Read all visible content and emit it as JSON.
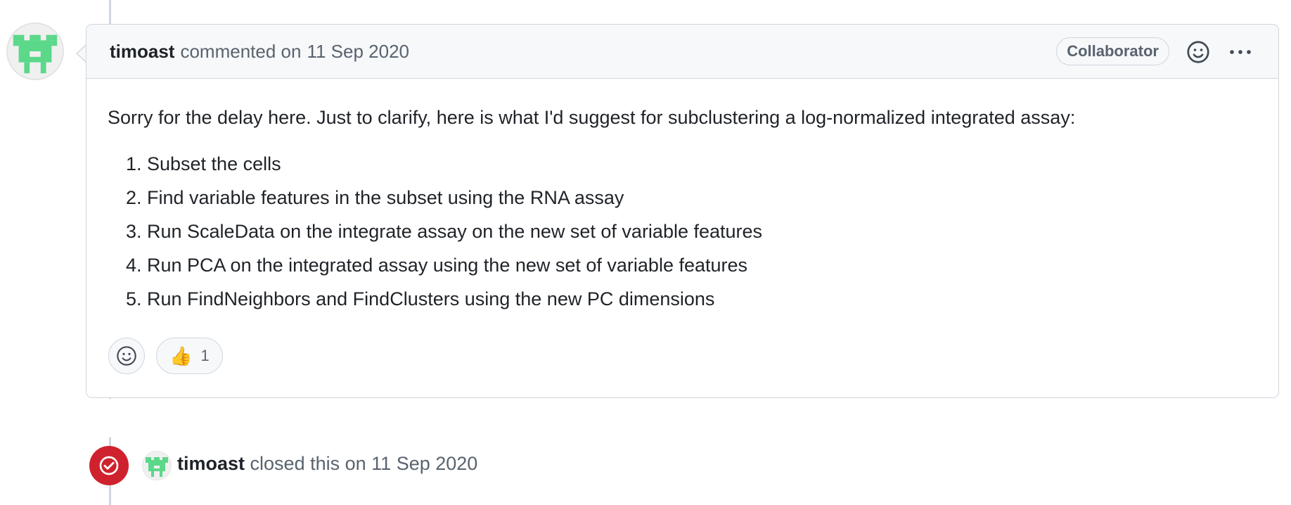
{
  "comment": {
    "author": "timoast",
    "action": "commented on",
    "date": "11 Sep 2020",
    "role_badge": "Collaborator",
    "body": "Sorry for the delay here. Just to clarify, here is what I'd suggest for subclustering a log-normalized integrated assay:",
    "steps": [
      "Subset the cells",
      "Find variable features in the subset using the RNA assay",
      "Run ScaleData on the integrate assay on the new set of variable features",
      "Run PCA on the integrated assay using the new set of variable features",
      "Run FindNeighbors and FindClusters using the new PC dimensions"
    ],
    "reactions": [
      {
        "emoji": "👍",
        "icon": "thumbs-up-icon",
        "count": "1"
      }
    ]
  },
  "event": {
    "author": "timoast",
    "action": "closed this on",
    "date": "11 Sep 2020"
  },
  "colors": {
    "closed": "#cf222e",
    "avatar_green": "#5bd88a",
    "border": "#d0d7de",
    "header_bg": "#f6f8fa"
  }
}
